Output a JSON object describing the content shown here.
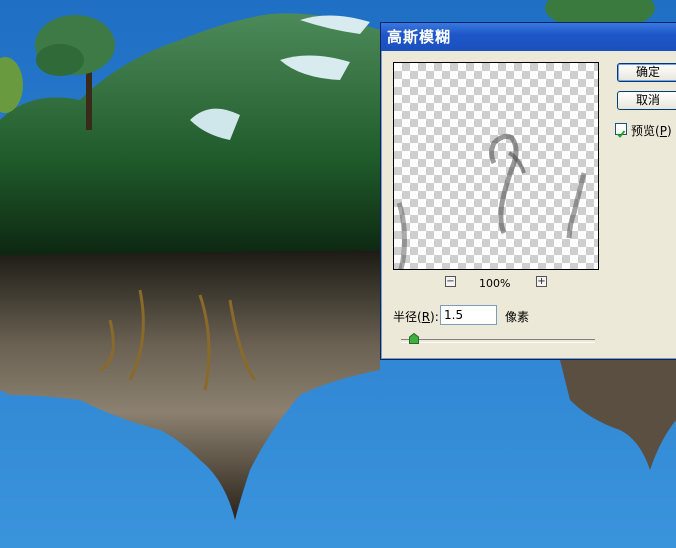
{
  "dialog": {
    "title": "高斯模糊",
    "ok_label": "确定",
    "cancel_label": "取消",
    "preview_checkbox": {
      "label_prefix": "预览(",
      "key": "P",
      "label_suffix": ")",
      "checked": true
    },
    "zoom_level": "100%",
    "zoom_out_icon": "minus-icon",
    "zoom_in_icon": "plus-icon",
    "radius": {
      "label_prefix": "半径(",
      "key": "R",
      "label_suffix": "):",
      "value": "1.5",
      "unit": "像素"
    },
    "slider_level": 0.05
  },
  "colors": {
    "title_bar": "#1f57c8",
    "dialog_bg": "#ece9d8",
    "sky": "#2f86d4"
  }
}
